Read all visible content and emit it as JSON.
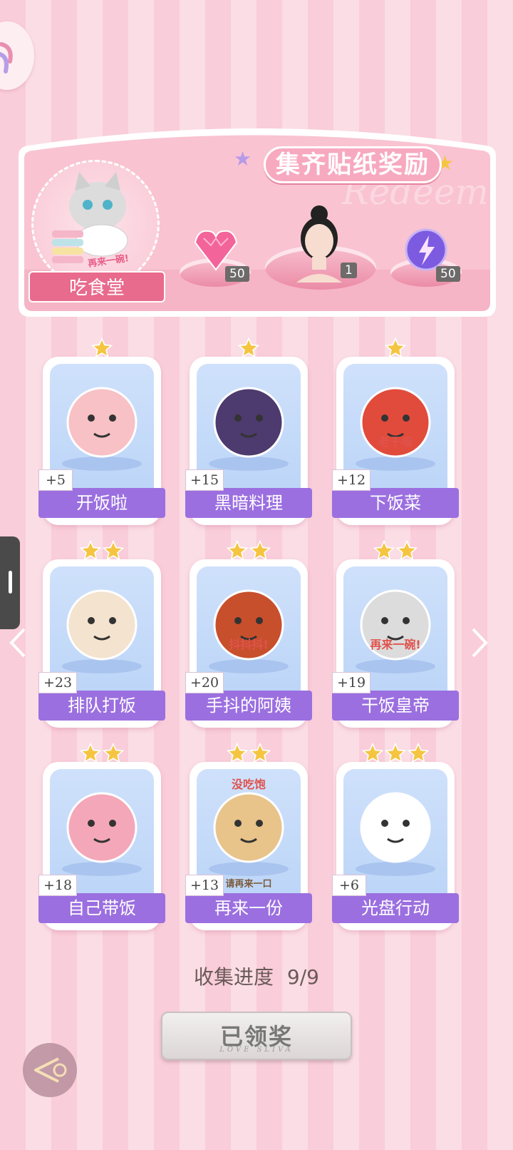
{
  "banner": {
    "title": "集齐贴纸奖励",
    "watermark": "Redeem",
    "avatar_label": "吃食堂",
    "avatar_sticker_text": "再来一碗!",
    "rewards": [
      {
        "name": "pink-gem-icon",
        "count": "50"
      },
      {
        "name": "lady-portrait",
        "count": "1"
      },
      {
        "name": "lightning-orb-icon",
        "count": "50"
      }
    ]
  },
  "cards": [
    {
      "label": "开饭啦",
      "bonus": "+5",
      "stars": 1,
      "art": "pig-icon"
    },
    {
      "label": "黑暗料理",
      "bonus": "+15",
      "stars": 1,
      "art": "dark-dish-icon"
    },
    {
      "label": "下饭菜",
      "bonus": "+12",
      "stars": 1,
      "art": "chili-jar-icon",
      "art_text": "老干喵"
    },
    {
      "label": "排队打饭",
      "bonus": "+23",
      "stars": 2,
      "art": "queue-animals-icon"
    },
    {
      "label": "手抖的阿姨",
      "bonus": "+20",
      "stars": 2,
      "art": "ladle-icon",
      "art_text": "抖抖抖!"
    },
    {
      "label": "干饭皇帝",
      "bonus": "+19",
      "stars": 2,
      "art": "cat-bowl-icon",
      "art_text": "再来一碗!"
    },
    {
      "label": "自己带饭",
      "bonus": "+18",
      "stars": 2,
      "art": "lunchbox-icon"
    },
    {
      "label": "再来一份",
      "bonus": "+13",
      "stars": 2,
      "art": "hamster-icon",
      "art_text": "没吃饱",
      "art_text2": "请再来一口"
    },
    {
      "label": "光盘行动",
      "bonus": "+6",
      "stars": 3,
      "art": "bunny-plate-icon"
    }
  ],
  "progress": {
    "label": "收集进度",
    "value": "9/9"
  },
  "claim_button": {
    "label": "已领奖",
    "sub": "LOVE SLIVA"
  },
  "colors": {
    "accent": "#9b6fe0",
    "banner": "#f7a9bf",
    "star": "#f5c542"
  }
}
